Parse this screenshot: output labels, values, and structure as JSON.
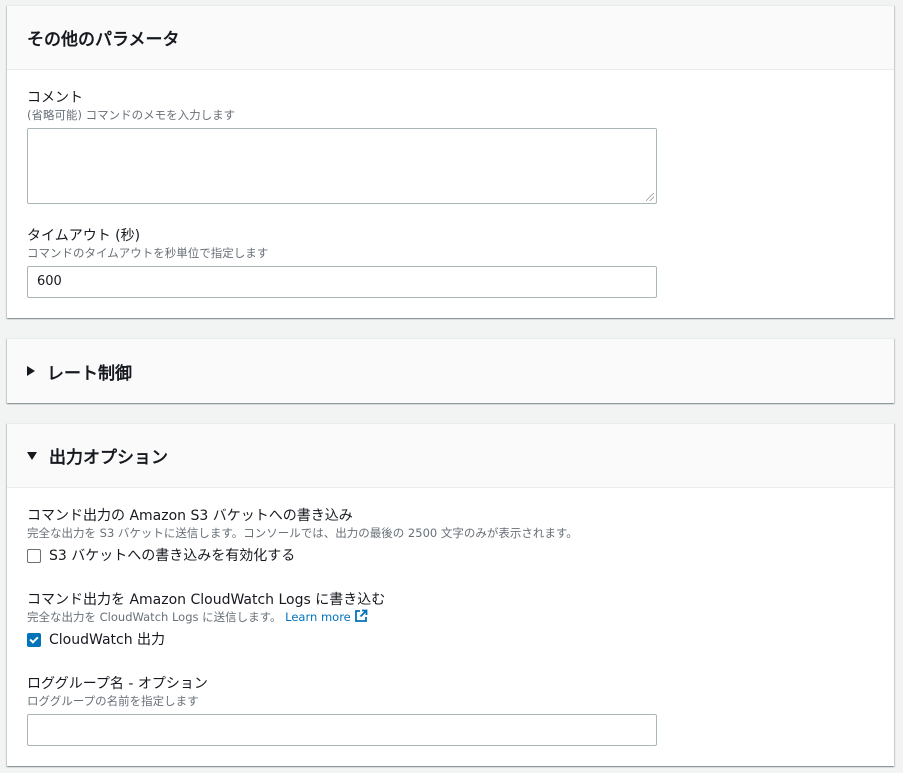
{
  "other_params": {
    "title": "その他のパラメータ",
    "comment": {
      "label": "コメント",
      "description": "(省略可能) コマンドのメモを入力します",
      "value": ""
    },
    "timeout": {
      "label": "タイムアウト (秒)",
      "description": "コマンドのタイムアウトを秒単位で指定します",
      "value": "600"
    }
  },
  "rate_control": {
    "title": "レート制御",
    "expanded": false
  },
  "output_options": {
    "title": "出力オプション",
    "expanded": true,
    "s3": {
      "label": "コマンド出力の Amazon S3 バケットへの書き込み",
      "description": "完全な出力を S3 バケットに送信します。コンソールでは、出力の最後の 2500 文字のみが表示されます。",
      "checkbox_label": "S3 バケットへの書き込みを有効化する",
      "checked": false
    },
    "cloudwatch": {
      "label": "コマンド出力を Amazon CloudWatch Logs に書き込む",
      "description": "完全な出力を CloudWatch Logs に送信します。",
      "learn_more": "Learn more",
      "checkbox_label": "CloudWatch 出力",
      "checked": true
    },
    "log_group": {
      "label": "ロググループ名 - オプション",
      "description": "ロググループの名前を指定します",
      "value": ""
    }
  },
  "colors": {
    "accent": "#0073bb",
    "background": "#f2f3f3",
    "text": "#16191f",
    "muted": "#687078"
  }
}
